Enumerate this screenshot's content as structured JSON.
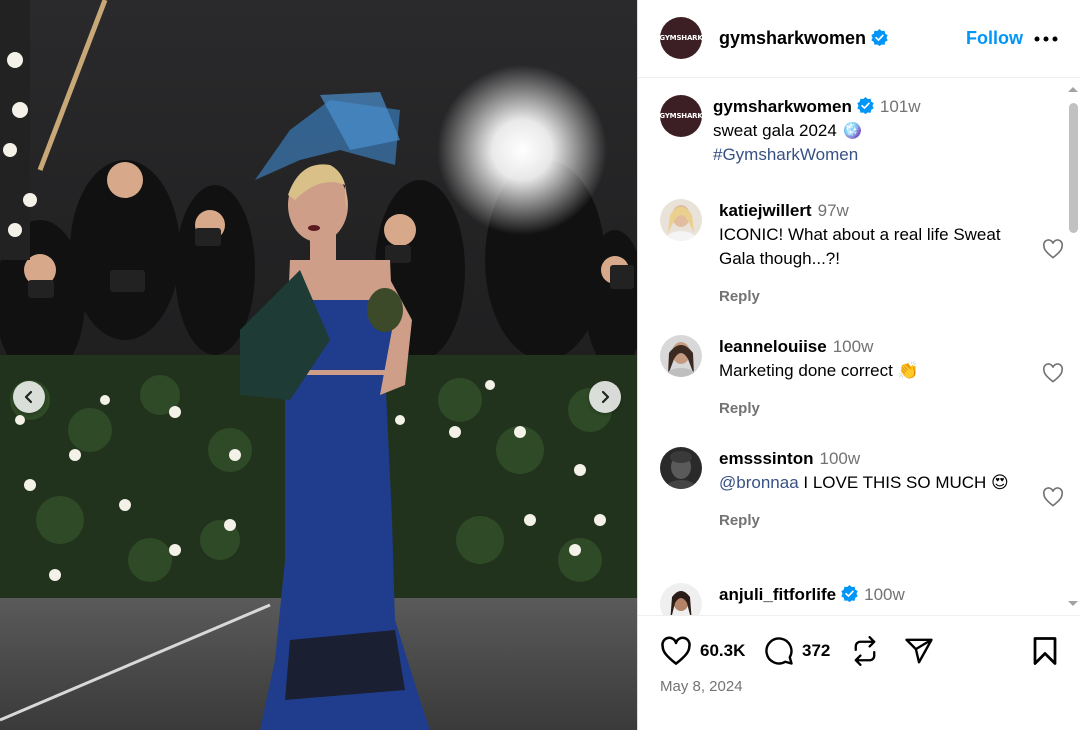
{
  "post": {
    "brand_avatar_text": "GYMSHARK",
    "username": "gymsharkwomen",
    "follow_label": "Follow"
  },
  "caption": {
    "username": "gymsharkwomen",
    "age": "101w",
    "text": "sweat gala 2024 🪩",
    "hashtag": "#GymsharkWomen"
  },
  "comments": [
    {
      "username": "katiejwillert",
      "age": "97w",
      "mention": "",
      "text": "ICONIC! What about a real life Sweat Gala though...?!",
      "reply": "Reply"
    },
    {
      "username": "leannelouiise",
      "age": "100w",
      "mention": "",
      "text": "Marketing done correct 👏",
      "reply": "Reply"
    },
    {
      "username": "emsssinton",
      "age": "100w",
      "mention": "@bronnaa",
      "text": " I LOVE THIS SO MUCH 😍",
      "reply": "Reply"
    },
    {
      "username": "anjuli_fitforlife",
      "age": "100w",
      "mention": "",
      "text": "",
      "reply": ""
    }
  ],
  "stats": {
    "likes": "60.3K",
    "comments": "372",
    "date": "May 8, 2024"
  },
  "colors": {
    "accent_blue": "#0095f6",
    "link_blue": "#385185",
    "verified_blue": "#0095f6",
    "muted": "#737373",
    "dress_blue": "#1f3d8c"
  },
  "icons": [
    "prev-arrow-icon",
    "next-arrow-icon",
    "verified-icon",
    "more-icon",
    "heart-icon",
    "comment-icon",
    "repost-icon",
    "share-icon",
    "bookmark-icon"
  ]
}
